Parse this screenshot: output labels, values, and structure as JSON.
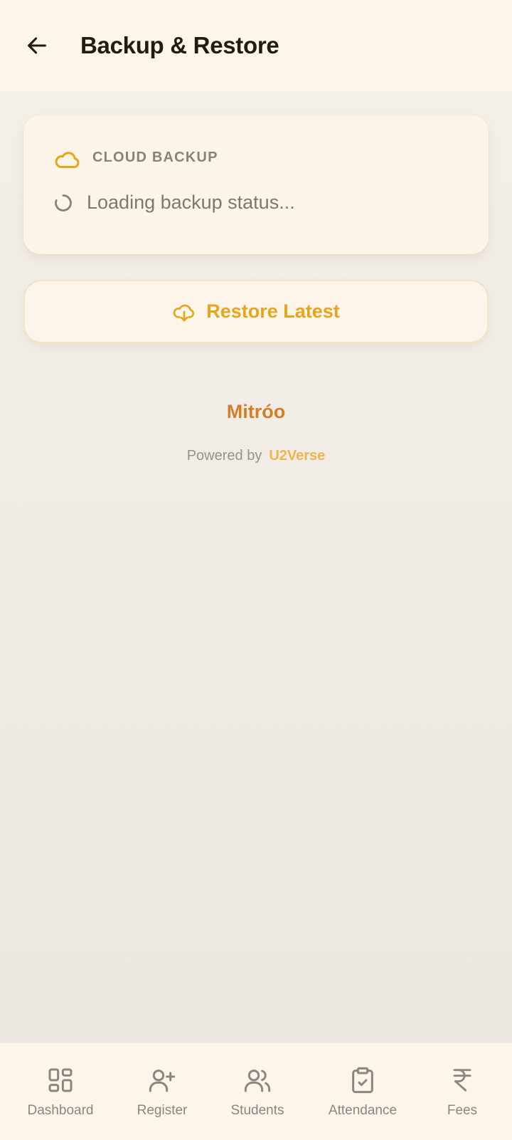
{
  "header": {
    "title": "Backup & Restore",
    "back_icon": "arrow-left-icon"
  },
  "card": {
    "label": "CLOUD BACKUP",
    "icon": "cloud-icon",
    "status": "Loading backup status...",
    "status_icon": "spinner-icon"
  },
  "restore_button": {
    "label": "Restore Latest",
    "icon": "cloud-download-icon"
  },
  "footer": {
    "brand": "Mitróo",
    "powered_by": "Powered by",
    "powered_brand": "U2Verse"
  },
  "bottom_nav": [
    {
      "label": "Dashboard",
      "icon": "dashboard-icon"
    },
    {
      "label": "Register",
      "icon": "user-plus-icon"
    },
    {
      "label": "Students",
      "icon": "users-icon"
    },
    {
      "label": "Attendance",
      "icon": "clipboard-check-icon"
    },
    {
      "label": "Fees",
      "icon": "rupee-icon"
    }
  ],
  "colors": {
    "accent": "#e7a51d",
    "brand": "#d47f25",
    "header_bg": "#fdf5e9"
  }
}
